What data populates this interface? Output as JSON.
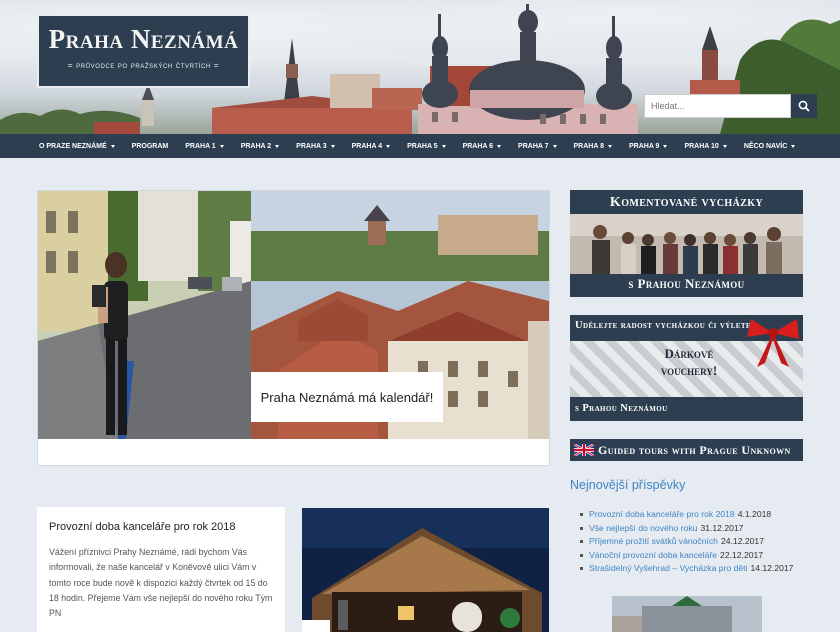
{
  "site": {
    "title": "Praha Neznámá",
    "subtitle": "= průvodce po pražských čtvrtích ="
  },
  "search": {
    "placeholder": "Hledat...",
    "icon": "search-icon"
  },
  "nav": {
    "items": [
      {
        "label": "O PRAZE NEZNÁMÉ",
        "dropdown": true
      },
      {
        "label": "PROGRAM",
        "dropdown": false
      },
      {
        "label": "PRAHA 1",
        "dropdown": true
      },
      {
        "label": "PRAHA 2",
        "dropdown": true
      },
      {
        "label": "PRAHA 3",
        "dropdown": true
      },
      {
        "label": "PRAHA 4",
        "dropdown": true
      },
      {
        "label": "PRAHA 5",
        "dropdown": true
      },
      {
        "label": "PRAHA 6",
        "dropdown": true
      },
      {
        "label": "PRAHA 7",
        "dropdown": true
      },
      {
        "label": "PRAHA 8",
        "dropdown": true
      },
      {
        "label": "PRAHA 9",
        "dropdown": true
      },
      {
        "label": "PRAHA 10",
        "dropdown": true
      },
      {
        "label": "NĚCO NAVÍC",
        "dropdown": true
      }
    ]
  },
  "slider": {
    "caption": "Praha Neznámá má kalendář!"
  },
  "post": {
    "title": "Provozní doba kanceláře pro rok 2018",
    "text": "Vážení příznivci Prahy Neznámé, rádi bychom Vás informovali, že naše kancelář v Koněvově ulici Vám v tomto roce bude nově k dispozici každý čtvrtek od 15 do 18 hodin. Přejeme Vám vše nejlepší do nového roku Tým PN"
  },
  "sidebar": {
    "banner1": {
      "title": "Komentované vycházky",
      "footer": "s Prahou Neznámou"
    },
    "banner2": {
      "title": "Udělejte radost vycházkou či výletem",
      "center": "Dárkové vouchery!",
      "footer": "s Prahou Neznámou"
    },
    "banner3": {
      "title": "Guided tours with Prague Unknown"
    },
    "recent_title": "Nejnovější příspěvky",
    "recent": [
      {
        "title": "Provozní doba kanceláře pro rok 2018",
        "date": "4.1.2018"
      },
      {
        "title": "Vše nejlepší do nového roku",
        "date": "31.12.2017"
      },
      {
        "title": "Příjemné prožití svátků vánočních",
        "date": "24.12.2017"
      },
      {
        "title": "Vánoční provozní doba kanceláře",
        "date": "22.12.2017"
      },
      {
        "title": "Strašidelný Vyšehrad – Vycházka pro děti",
        "date": "14.12.2017"
      }
    ]
  },
  "colors": {
    "navy": "#2c3e50",
    "link": "#3f85c4",
    "bg": "#e6ebf1",
    "ribbon": "#d81e1e"
  }
}
